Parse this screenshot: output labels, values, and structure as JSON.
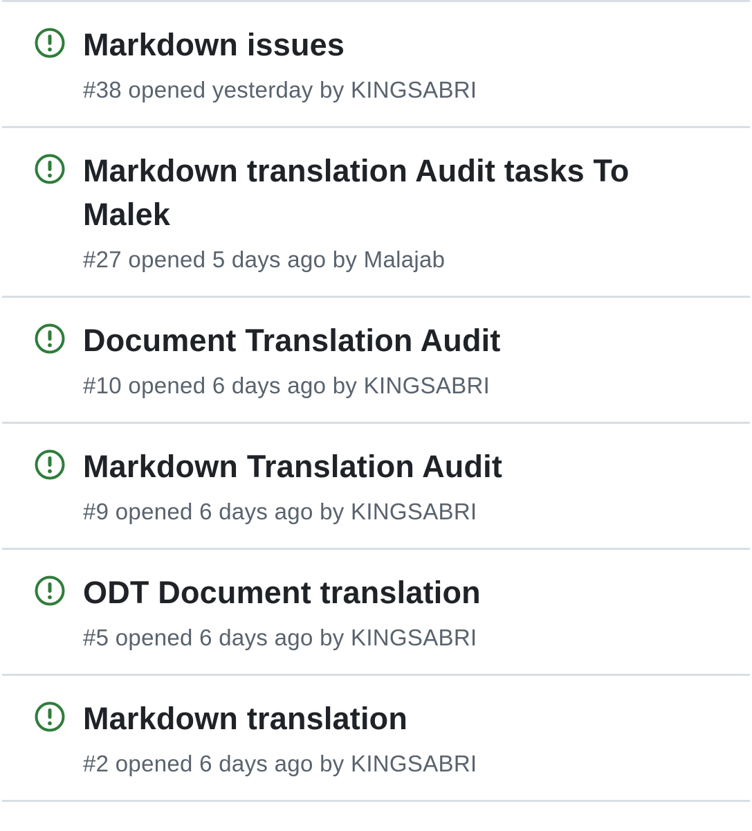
{
  "issues": [
    {
      "icon": "issue-open-icon",
      "title": "Markdown issues",
      "meta": "#38 opened yesterday by KINGSABRI"
    },
    {
      "icon": "issue-open-icon",
      "title": "Markdown translation Audit tasks To Malek",
      "meta": "#27 opened 5 days ago by Malajab"
    },
    {
      "icon": "issue-open-icon",
      "title": "Document Translation Audit",
      "meta": "#10 opened 6 days ago by KINGSABRI"
    },
    {
      "icon": "issue-open-icon",
      "title": "Markdown Translation Audit",
      "meta": "#9 opened 6 days ago by KINGSABRI"
    },
    {
      "icon": "issue-open-icon",
      "title": "ODT Document translation",
      "meta": "#5 opened 6 days ago by KINGSABRI"
    },
    {
      "icon": "issue-open-icon",
      "title": "Markdown translation",
      "meta": "#2 opened 6 days ago by KINGSABRI"
    }
  ],
  "colors": {
    "open_icon": "#2f7d3b",
    "title": "#1f2328",
    "meta": "#59636e",
    "divider": "#d8dee4"
  }
}
